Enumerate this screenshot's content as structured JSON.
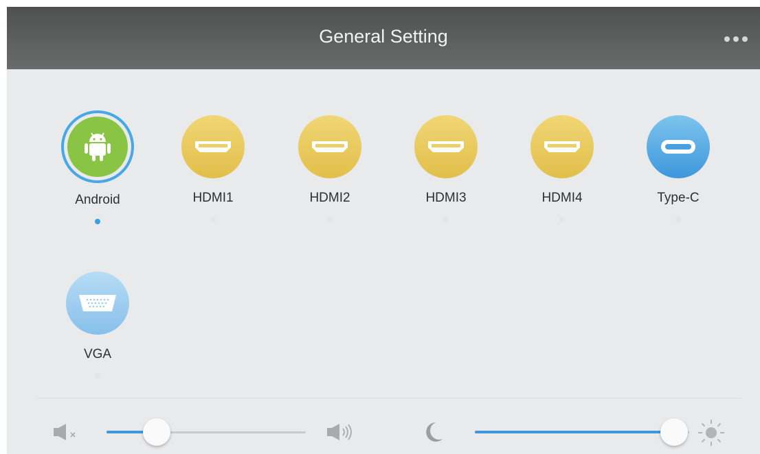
{
  "header": {
    "title": "General Setting",
    "more_icon": "more-dots-icon"
  },
  "sources": [
    {
      "label": "Android",
      "icon": "android-icon",
      "selected": true
    },
    {
      "label": "HDMI1",
      "icon": "hdmi-port-icon",
      "selected": false
    },
    {
      "label": "HDMI2",
      "icon": "hdmi-port-icon",
      "selected": false
    },
    {
      "label": "HDMI3",
      "icon": "hdmi-port-icon",
      "selected": false
    },
    {
      "label": "HDMI4",
      "icon": "hdmi-port-icon",
      "selected": false
    },
    {
      "label": "Type-C",
      "icon": "usb-c-port-icon",
      "selected": false
    },
    {
      "label": "VGA",
      "icon": "vga-port-icon",
      "selected": false
    }
  ],
  "volume": {
    "value": 0.25,
    "min_icon": "mute-icon",
    "max_icon": "volume-high-icon"
  },
  "brightness": {
    "value": 0.93,
    "min_icon": "moon-icon",
    "max_icon": "sun-icon"
  },
  "colors": {
    "accent": "#3e97dd",
    "android": "#8ac445",
    "hdmi": "#e6c550",
    "typec": "#4a9fe0",
    "vga": "#9dcdee",
    "header": "#5b5c5c"
  }
}
